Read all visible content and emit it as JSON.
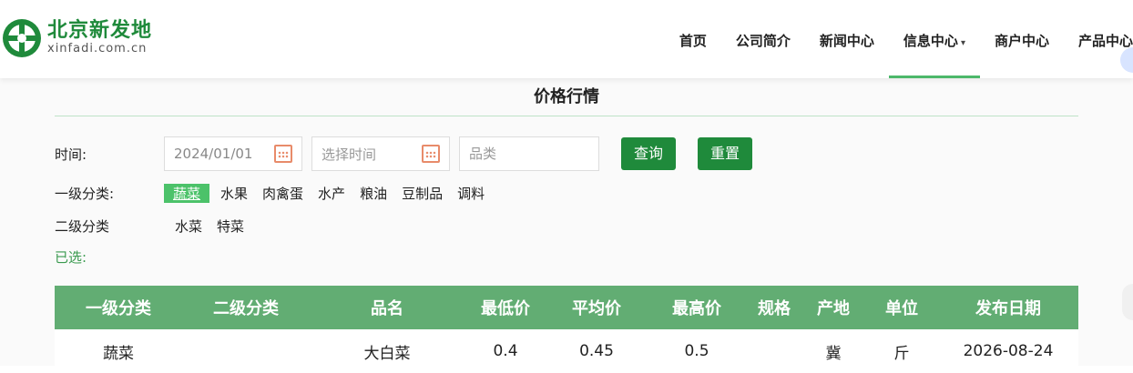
{
  "logo": {
    "cn": "北京新发地",
    "en": "xinfadi.com.cn"
  },
  "nav": {
    "items": [
      {
        "label": "首页"
      },
      {
        "label": "公司简介"
      },
      {
        "label": "新闻中心"
      },
      {
        "label": "信息中心",
        "caret": "▾"
      },
      {
        "label": "商户中心"
      },
      {
        "label": "产品中心"
      }
    ]
  },
  "page": {
    "title": "价格行情"
  },
  "filters": {
    "time_label": "时间:",
    "start_date": "2024/01/01",
    "end_date_placeholder": "选择时间",
    "category_placeholder": "品类",
    "query_button": "查询",
    "reset_button": "重置",
    "level1_label": "一级分类:",
    "level1_items": [
      "蔬菜",
      "水果",
      "肉禽蛋",
      "水产",
      "粮油",
      "豆制品",
      "调料"
    ],
    "level2_label": "二级分类",
    "level2_items": [
      "水菜",
      "特菜"
    ],
    "selected_label": "已选:"
  },
  "table": {
    "headers": [
      "一级分类",
      "二级分类",
      "品名",
      "最低价",
      "平均价",
      "最高价",
      "规格",
      "产地",
      "单位",
      "发布日期"
    ],
    "rows": [
      [
        "蔬菜",
        "",
        "大白菜",
        "0.4",
        "0.45",
        "0.5",
        "",
        "冀",
        "斤",
        "2026-08-24"
      ]
    ]
  },
  "colors": {
    "brand_green": "#1f8a3b",
    "header_green": "#62ad73",
    "selected_green": "#4cc26a",
    "calendar_icon": "#e88b6a"
  }
}
